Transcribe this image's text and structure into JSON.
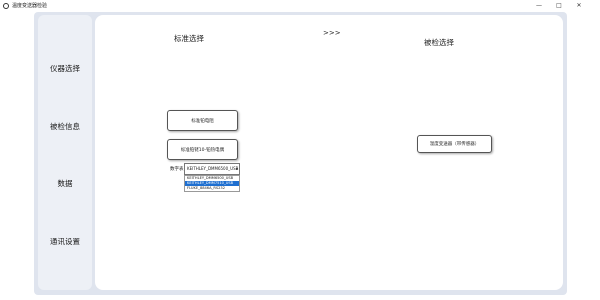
{
  "window": {
    "title": "温度变送器检验",
    "minimize": "—",
    "restore": "□",
    "close": "✕"
  },
  "sidebar": {
    "items": [
      {
        "label": "仪器选择"
      },
      {
        "label": "被检信息"
      },
      {
        "label": "数据"
      },
      {
        "label": "通讯设置"
      }
    ]
  },
  "main": {
    "standard_heading": "标准选择",
    "arrow": ">>>",
    "tested_heading": "被检选择",
    "standard_resistor_button": "标准铂电阻",
    "standard_thermocouple_button": "标准铂铑10-铂热电偶",
    "meter_label": "数字表",
    "meter_select_value": "KEITHLEY_DMM6500_USB",
    "meter_options": [
      "KEITHLEY_DMM6500_USB",
      "KEITHLEY_DMM7510_USB",
      "FLUKE_8846A_RS232"
    ],
    "meter_selected_index": 1,
    "temp_transmitter_button": "温度变送器（带传感器）"
  }
}
